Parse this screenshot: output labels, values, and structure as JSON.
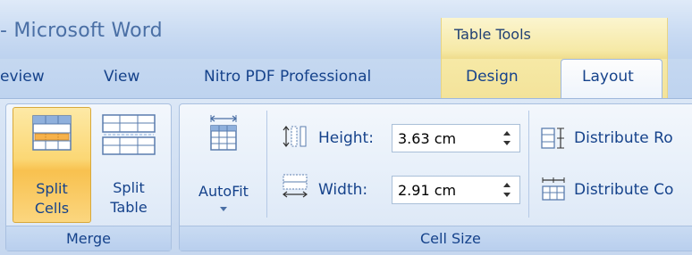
{
  "window": {
    "app_title": "- Microsoft Word"
  },
  "contextual": {
    "label": "Table Tools"
  },
  "tabs": [
    {
      "label": "eview"
    },
    {
      "label": "View"
    },
    {
      "label": "Nitro PDF Professional"
    },
    {
      "label": "Design"
    },
    {
      "label": "Layout",
      "selected": true
    }
  ],
  "merge_group": {
    "label": "Merge",
    "split_cells": {
      "line1": "Split",
      "line2": "Cells",
      "active": true
    },
    "split_table": {
      "line1": "Split",
      "line2": "Table"
    }
  },
  "cell_size_group": {
    "label": "Cell Size",
    "autofit": {
      "label": "AutoFit"
    },
    "height": {
      "label": "Height:",
      "value": "3.63 cm"
    },
    "width": {
      "label": "Width:",
      "value": "2.91 cm"
    },
    "distribute_rows": {
      "label": "Distribute Ro"
    },
    "distribute_columns": {
      "label": "Distribute Co"
    }
  },
  "colors": {
    "accent_text": "#15428b",
    "contextual_tab": "#f6e9a6",
    "active_button": "#fbd774"
  }
}
